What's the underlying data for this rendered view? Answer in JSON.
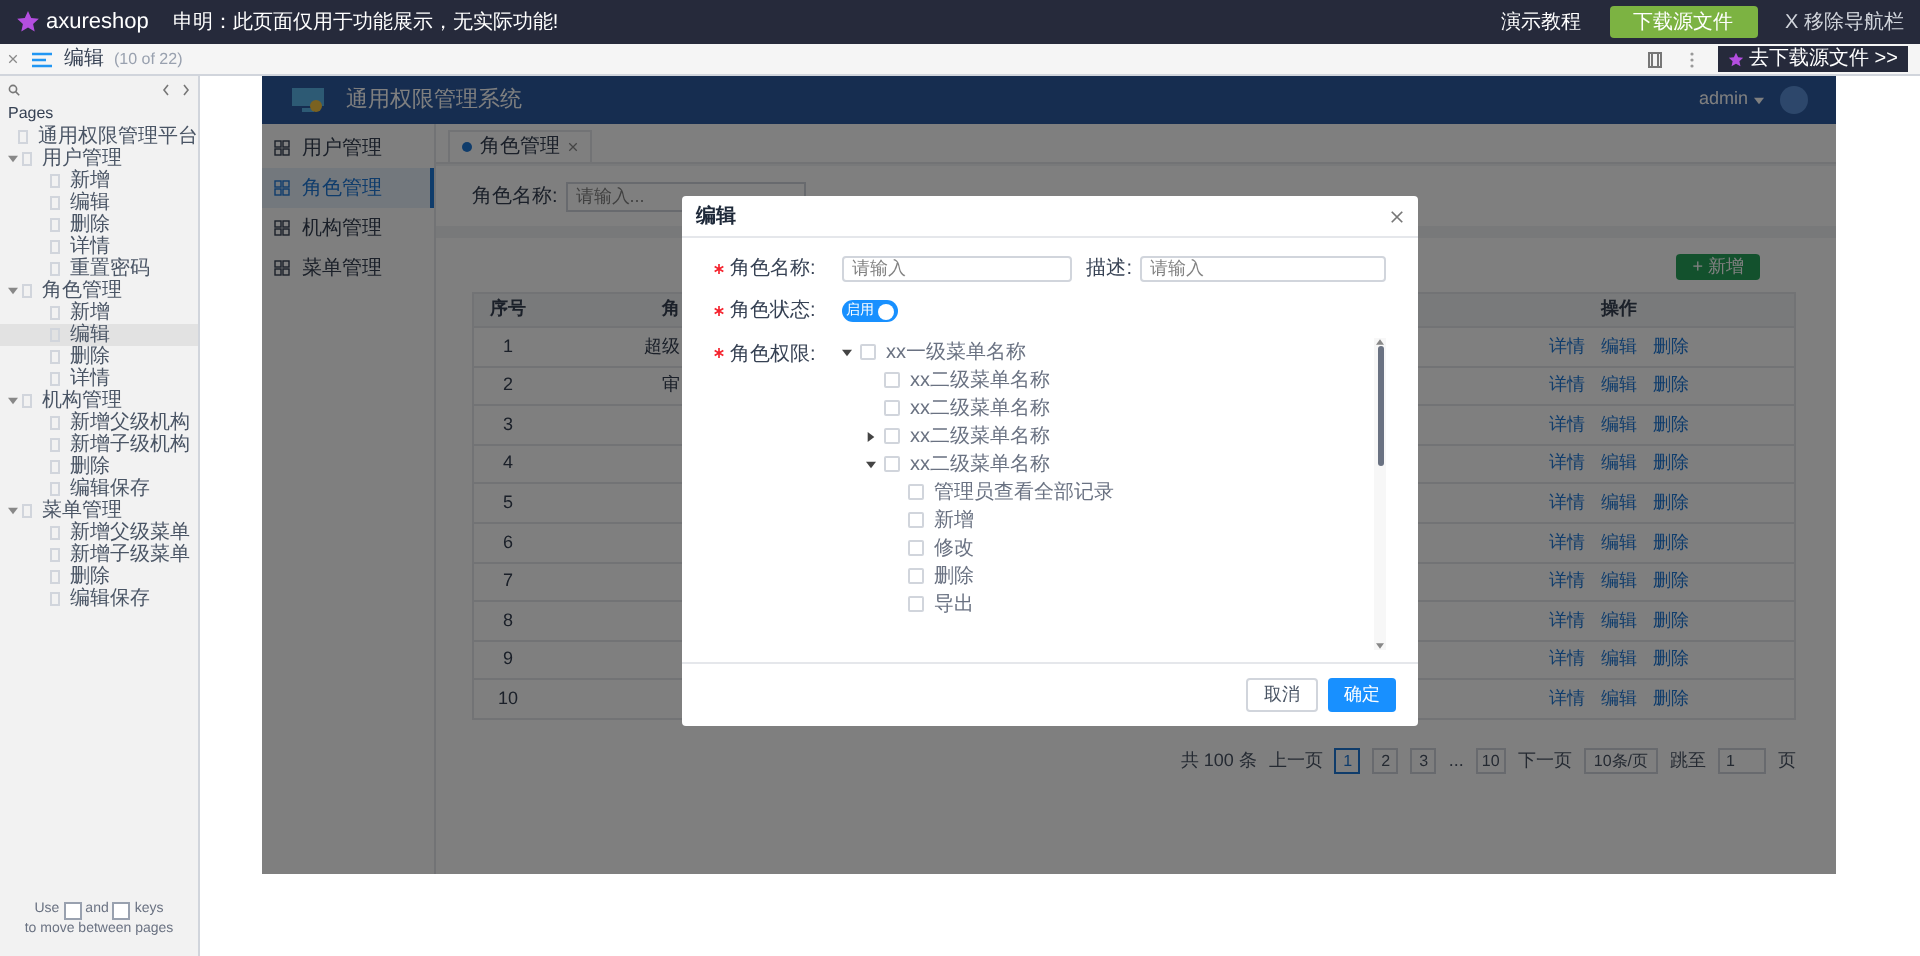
{
  "topbar": {
    "logo": "axureshop",
    "notice": "申明：此页面仅用于功能展示，无实际功能!",
    "tutorial": "演示教程",
    "download": "下载源文件",
    "remove": "X 移除导航栏"
  },
  "pagebar": {
    "page": "编辑",
    "count": "(10 of 22)",
    "promo": "去下载源文件 >>"
  },
  "sidebar": {
    "title": "Pages",
    "items": [
      {
        "label": "通用权限管理平台",
        "selected": false
      },
      {
        "label": "用户管理",
        "selected": false,
        "expanded": true,
        "children": [
          {
            "label": "新增",
            "selected": false
          },
          {
            "label": "编辑",
            "selected": false
          },
          {
            "label": "删除",
            "selected": false
          },
          {
            "label": "详情",
            "selected": false
          },
          {
            "label": "重置密码",
            "selected": false
          }
        ]
      },
      {
        "label": "角色管理",
        "selected": false,
        "expanded": true,
        "children": [
          {
            "label": "新增",
            "selected": false
          },
          {
            "label": "编辑",
            "selected": true
          },
          {
            "label": "删除",
            "selected": false
          },
          {
            "label": "详情",
            "selected": false
          }
        ]
      },
      {
        "label": "机构管理",
        "selected": false,
        "expanded": true,
        "children": [
          {
            "label": "新增父级机构",
            "selected": false
          },
          {
            "label": "新增子级机构",
            "selected": false
          },
          {
            "label": "删除",
            "selected": false
          },
          {
            "label": "编辑保存",
            "selected": false
          }
        ]
      },
      {
        "label": "菜单管理",
        "selected": false,
        "expanded": true,
        "children": [
          {
            "label": "新增父级菜单",
            "selected": false
          },
          {
            "label": "新增子级菜单",
            "selected": false
          },
          {
            "label": "删除",
            "selected": false
          },
          {
            "label": "编辑保存",
            "selected": false
          }
        ]
      }
    ],
    "hint": [
      "Use",
      "and",
      "keys",
      "to move between pages"
    ]
  },
  "app": {
    "title": "通用权限管理系统",
    "user": "admin",
    "nav": [
      {
        "label": "用户管理",
        "selected": false
      },
      {
        "label": "角色管理",
        "selected": true
      },
      {
        "label": "机构管理",
        "selected": false
      },
      {
        "label": "菜单管理",
        "selected": false
      }
    ],
    "tab": "角色管理",
    "filter": {
      "label": "角色名称:",
      "placeholder": "请输入..."
    },
    "add": "+ 新增",
    "table": {
      "columns": [
        "序号",
        "角",
        "操作"
      ],
      "rows": [
        {
          "index": "1",
          "column_2": "超级",
          "actions": [
            "详情",
            "编辑",
            "删除"
          ]
        },
        {
          "index": "2",
          "column_2": "审",
          "actions": [
            "详情",
            "编辑",
            "删除"
          ]
        },
        {
          "index": "3",
          "actions": [
            "详情",
            "编辑",
            "删除"
          ]
        },
        {
          "index": "4",
          "actions": [
            "详情",
            "编辑",
            "删除"
          ]
        },
        {
          "index": "5",
          "actions": [
            "详情",
            "编辑",
            "删除"
          ]
        },
        {
          "index": "6",
          "actions": [
            "详情",
            "编辑",
            "删除"
          ]
        },
        {
          "index": "7",
          "actions": [
            "详情",
            "编辑",
            "删除"
          ]
        },
        {
          "index": "8",
          "actions": [
            "详情",
            "编辑",
            "删除"
          ]
        },
        {
          "index": "9",
          "actions": [
            "详情",
            "编辑",
            "删除"
          ]
        },
        {
          "index": "10",
          "actions": [
            "详情",
            "编辑",
            "删除"
          ]
        }
      ]
    },
    "pagination": {
      "total": "共 100 条",
      "prev": "上一页",
      "pages": [
        {
          "label": "1",
          "selected": true
        },
        {
          "label": "2",
          "selected": false
        },
        {
          "label": "3",
          "selected": false
        }
      ],
      "ellipsis": "...",
      "last": "10",
      "next": "下一页",
      "size": "10条/页",
      "jump": "跳至",
      "jump_value": "1",
      "unit": "页"
    }
  },
  "modal": {
    "title": "编辑",
    "name_required": true,
    "status_required": true,
    "perm_required": true,
    "name_label": "角色名称:",
    "name_placeholder": "请输入",
    "desc_label": "描述:",
    "desc_placeholder": "请输入",
    "status_label": "角色状态:",
    "status": {
      "label": "启用",
      "on": true
    },
    "perm_label": "角色权限:",
    "tree": [
      {
        "label": "xx一级菜单名称",
        "checked": false,
        "expanded": true,
        "children": [
          {
            "label": "xx二级菜单名称",
            "checked": false
          },
          {
            "label": "xx二级菜单名称",
            "checked": false
          },
          {
            "label": "xx二级菜单名称",
            "checked": false,
            "expanded": false
          },
          {
            "label": "xx二级菜单名称",
            "checked": false,
            "expanded": true,
            "children": [
              {
                "label": "管理员查看全部记录",
                "checked": false
              },
              {
                "label": "新增",
                "checked": false
              },
              {
                "label": "修改",
                "checked": false
              },
              {
                "label": "删除",
                "checked": false
              },
              {
                "label": "导出",
                "checked": false
              }
            ]
          }
        ]
      }
    ],
    "cancel": "取消",
    "ok": "确定"
  }
}
